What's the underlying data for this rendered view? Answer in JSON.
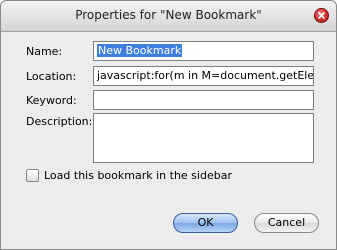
{
  "window": {
    "title": "Properties for \"New Bookmark\""
  },
  "form": {
    "name_label": "Name:",
    "name_value": "New Bookmark",
    "location_label": "Location:",
    "location_value": "javascript:for(m in M=document.getElement:",
    "keyword_label": "Keyword:",
    "keyword_value": "",
    "description_label": "Description:",
    "description_value": "",
    "sidebar_checkbox_label": "Load this bookmark in the sidebar",
    "sidebar_checked": false
  },
  "buttons": {
    "ok": "OK",
    "cancel": "Cancel"
  },
  "icons": {
    "close": "close-icon",
    "checkbox": "checkbox-unchecked"
  },
  "colors": {
    "selection": "#3d80df",
    "ok_button": "#9fc1ef",
    "close_button": "#d12a2a"
  }
}
